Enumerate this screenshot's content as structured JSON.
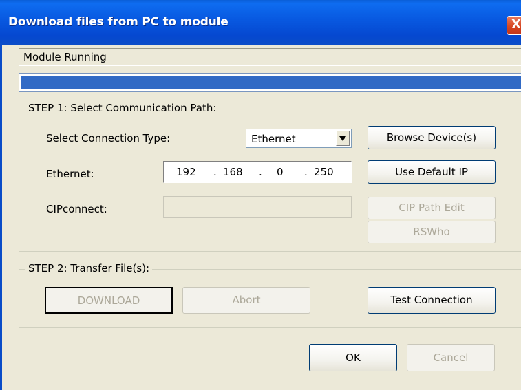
{
  "window": {
    "title": "Download files from PC to module",
    "close_glyph": "X"
  },
  "status": {
    "text": "Module Running",
    "progress_percent": 100
  },
  "step1": {
    "label": "STEP 1: Select Communication Path:",
    "connection_type_label": "Select Connection Type:",
    "connection_type_value": "Ethernet",
    "ethernet_label": "Ethernet:",
    "ip": [
      "192",
      "168",
      "0",
      "250"
    ],
    "ip_dots": [
      ".",
      ".",
      "."
    ],
    "cipconnect_label": "CIPconnect:",
    "cipconnect_value": "",
    "browse_label": "Browse Device(s)",
    "default_ip_label": "Use Default IP",
    "cip_path_label": "CIP Path Edit",
    "rswho_label": "RSWho"
  },
  "step2": {
    "label": "STEP 2: Transfer File(s):",
    "download_label": "DOWNLOAD",
    "abort_label": "Abort",
    "test_label": "Test Connection"
  },
  "footer": {
    "ok_label": "OK",
    "cancel_label": "Cancel"
  },
  "colors": {
    "titlebar": "#0548D0",
    "dialog_bg": "#ECE9D8",
    "progress_fill": "#316AC5",
    "close_button": "#D5431F"
  }
}
